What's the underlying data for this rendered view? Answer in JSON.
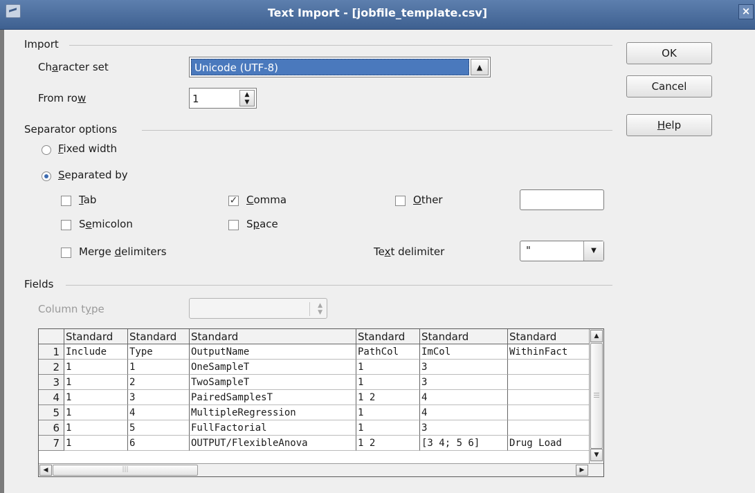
{
  "window": {
    "title": "Text Import - [jobfile_template.csv]"
  },
  "import": {
    "section_label": "Import",
    "charset_label_pre": "Ch",
    "charset_label_u": "a",
    "charset_label_post": "racter set",
    "charset_value": "Unicode (UTF-8)",
    "fromrow_label_pre": "From ro",
    "fromrow_label_u": "w",
    "fromrow_value": "1"
  },
  "separator": {
    "section_label": "Separator options",
    "fixed_u": "F",
    "fixed_rest": "ixed width",
    "separated_u": "S",
    "separated_rest": "eparated by",
    "selected": "separated",
    "tab_u": "T",
    "tab_rest": "ab",
    "tab_checked": false,
    "comma_u": "C",
    "comma_rest": "omma",
    "comma_checked": true,
    "other_u": "O",
    "other_rest": "ther",
    "other_checked": false,
    "other_value": "",
    "semicolon_pre": "S",
    "semicolon_u": "e",
    "semicolon_rest": "micolon",
    "semicolon_checked": false,
    "space_pre": "S",
    "space_u": "p",
    "space_rest": "ace",
    "space_checked": false,
    "merge_pre": "Merge ",
    "merge_u": "d",
    "merge_rest": "elimiters",
    "merge_checked": false,
    "textdelim_pre": "Te",
    "textdelim_u": "x",
    "textdelim_rest": "t delimiter",
    "textdelim_value": "\""
  },
  "fields": {
    "section_label": "Fields",
    "coltype_pre": "Column t",
    "coltype_u": "y",
    "coltype_rest": "pe",
    "coltype_value": ""
  },
  "grid": {
    "column_headers": [
      "Standard",
      "Standard",
      "Standard",
      "Standard",
      "Standard",
      "Standard"
    ],
    "row_numbers": [
      "1",
      "2",
      "3",
      "4",
      "5",
      "6",
      "7"
    ],
    "rows": [
      [
        "Include",
        "Type",
        "OutputName",
        "PathCol",
        "ImCol",
        "WithinFact"
      ],
      [
        "1",
        "1",
        "OneSampleT",
        "1",
        "3",
        ""
      ],
      [
        "1",
        "2",
        "TwoSampleT",
        "1",
        "3",
        ""
      ],
      [
        "1",
        "3",
        "PairedSamplesT",
        "1 2",
        "4",
        ""
      ],
      [
        "1",
        "4",
        "MultipleRegression",
        "1",
        "4",
        ""
      ],
      [
        "1",
        "5",
        "FullFactorial",
        "1",
        "3",
        ""
      ],
      [
        "1",
        "6",
        "OUTPUT/FlexibleAnova",
        "1 2",
        "[3 4; 5 6]",
        "Drug Load"
      ]
    ]
  },
  "buttons": {
    "ok": "OK",
    "cancel": "Cancel",
    "help_u": "H",
    "help_rest": "elp"
  }
}
